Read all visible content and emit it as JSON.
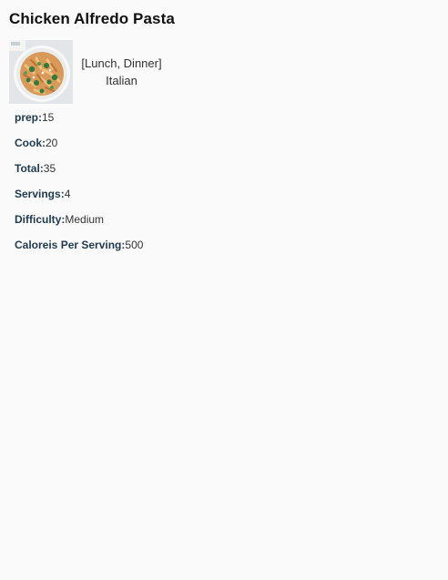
{
  "recipe": {
    "title": "Chicken Alfredo Pasta",
    "meal_types": "[Lunch, Dinner]",
    "cuisine": "Italian",
    "image_icon": "pasta-dish-photo"
  },
  "stats": [
    {
      "label": "prep:",
      "value": "15"
    },
    {
      "label": "Cook:",
      "value": "20"
    },
    {
      "label": "Total:",
      "value": "35"
    },
    {
      "label": "Servings:",
      "value": "4"
    },
    {
      "label": "Difficulty:",
      "value": "Medium"
    },
    {
      "label": "Caloreis Per Serving:",
      "value": "500"
    }
  ],
  "colors": {
    "background": "#fafafa",
    "label": "#1f3a4d",
    "text": "#333333"
  }
}
